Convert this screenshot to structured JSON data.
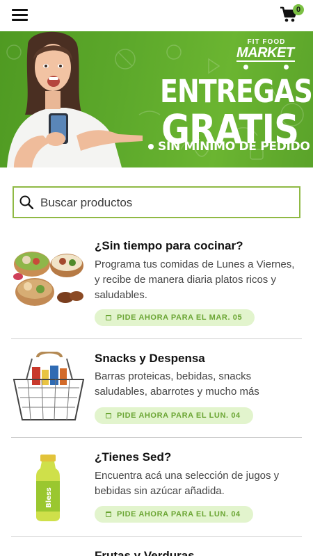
{
  "header": {
    "cart_count": "0",
    "menu_icon": "hamburger-menu-icon",
    "cart_icon": "shopping-cart-icon"
  },
  "banner": {
    "brand_top": "FIT FOOD",
    "brand_main": "MARKET",
    "title_line1": "ENTREGAS",
    "title_line2": "GRATIS",
    "subtitle": "SIN MÍNIMO DE PEDIDO",
    "background_color": "#5da92b"
  },
  "search": {
    "placeholder": "Buscar productos"
  },
  "categories": [
    {
      "title": "¿Sin tiempo para cocinar?",
      "description": "Programa tus comidas de Lunes a Viernes, y recibe de manera diaria platos ricos y saludables.",
      "button": "PIDE AHORA PARA EL MAR. 05"
    },
    {
      "title": "Snacks y Despensa",
      "description": "Barras proteicas, bebidas, snacks saludables, abarrotes y mucho más",
      "button": "PIDE AHORA PARA EL LUN. 04"
    },
    {
      "title": "¿Tienes Sed?",
      "description": "Encuentra acá una selección de jugos y bebidas sin azúcar añadida.",
      "button": "PIDE AHORA PARA EL LUN. 04"
    },
    {
      "title": "Frutas y Verduras"
    }
  ],
  "colors": {
    "accent": "#7bc043",
    "button_bg": "#e2f4cd",
    "button_text": "#6aa533",
    "search_border": "#8fb944"
  }
}
